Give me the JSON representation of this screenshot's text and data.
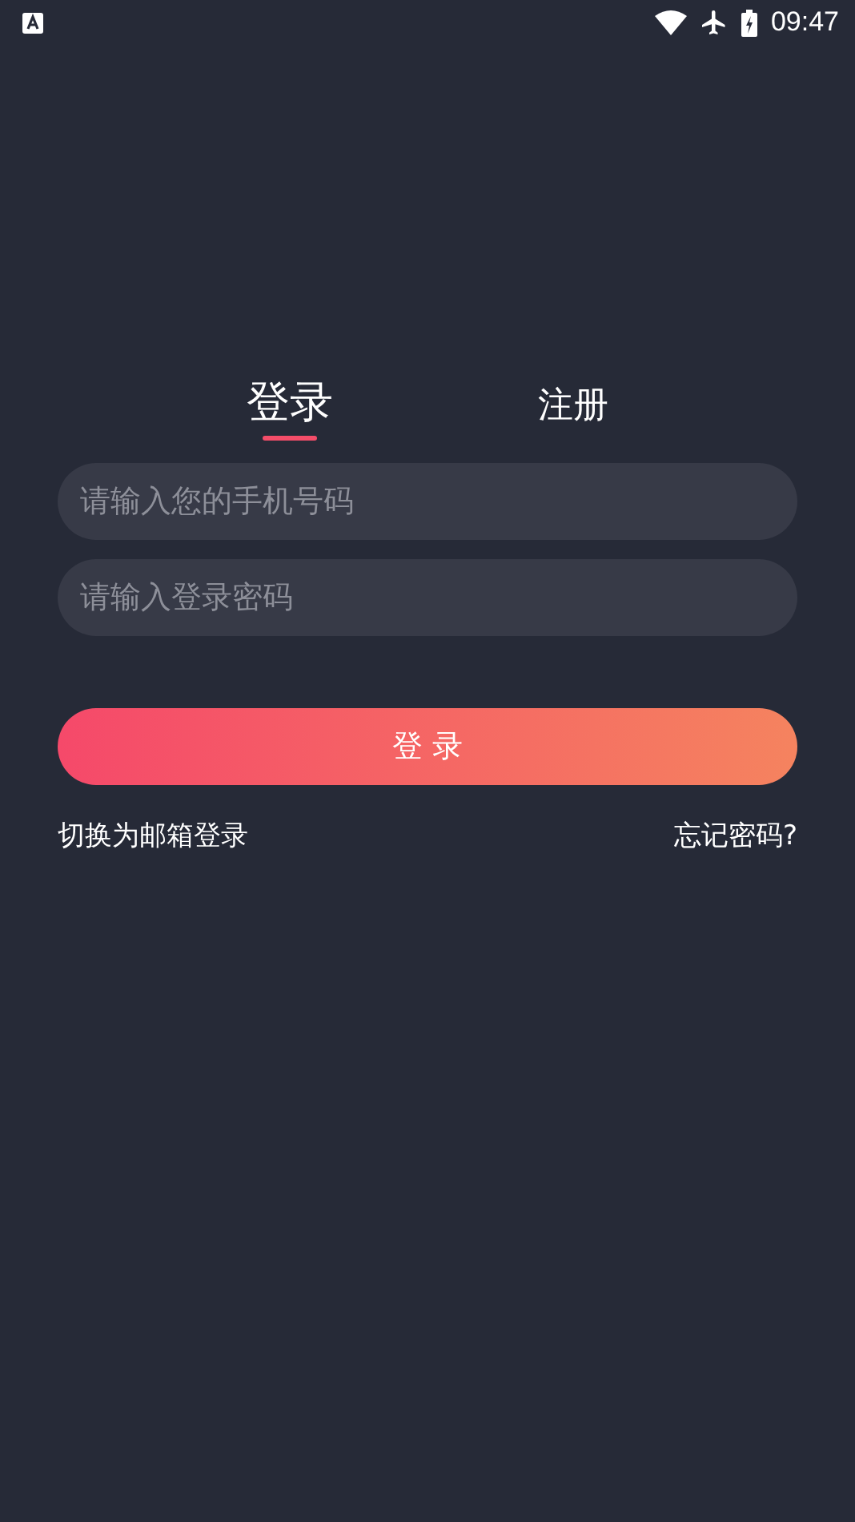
{
  "status_bar": {
    "time": "09:47"
  },
  "tabs": [
    {
      "label": "登录",
      "selected": true
    },
    {
      "label": "注册",
      "selected": false
    }
  ],
  "fields": [
    {
      "placeholder": "请输入您的手机号码"
    },
    {
      "placeholder": "请输入登录密码"
    }
  ],
  "login_button": "登 录",
  "links": {
    "switch_login": "切换为邮箱登录",
    "forgot_password": "忘记密码?"
  }
}
